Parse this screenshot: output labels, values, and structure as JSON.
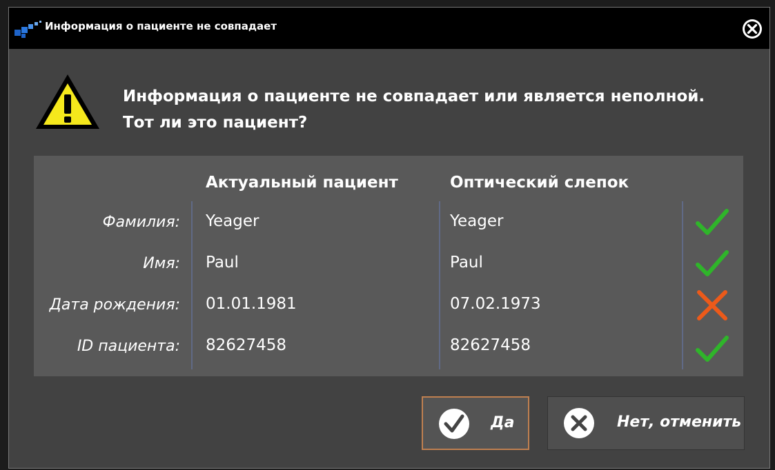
{
  "window": {
    "title": "Информация о пациенте не совпадает",
    "close_icon": "close-circle-icon"
  },
  "message": {
    "line1": "Информация о пациенте не совпадает или является неполной.",
    "line2": "Тот ли это пациент?",
    "icon": "warning-triangle-icon"
  },
  "table": {
    "headers": {
      "current": "Актуальный пациент",
      "optical": "Оптический слепок"
    },
    "rows": [
      {
        "label": "Фамилия:",
        "current": "Yeager",
        "optical": "Yeager",
        "match": true
      },
      {
        "label": "Имя:",
        "current": "Paul",
        "optical": "Paul",
        "match": true
      },
      {
        "label": "Дата рождения:",
        "current": "01.01.1981",
        "optical": "07.02.1973",
        "match": false
      },
      {
        "label": "ID пациента:",
        "current": "82627458",
        "optical": "82627458",
        "match": true
      }
    ]
  },
  "buttons": {
    "yes_label": "Да",
    "no_label": "Нет, отменить"
  },
  "colors": {
    "match": "#2fb52a",
    "mismatch": "#ec5a1a",
    "warning": "#f5e81c",
    "focus_border": "#c08050"
  }
}
